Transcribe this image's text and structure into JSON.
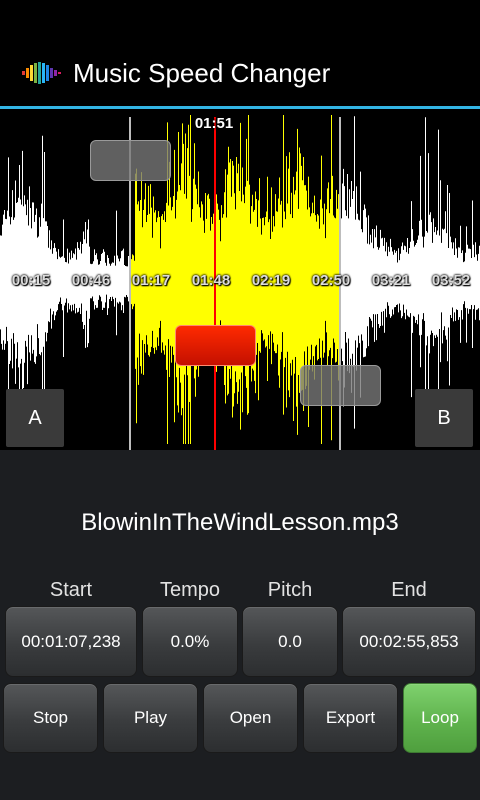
{
  "app": {
    "title": "Music Speed Changer",
    "accent_color": "#33b5e5",
    "logo_icon": "rainbow-waveform-icon"
  },
  "waveform": {
    "current_time": "01:51",
    "time_ticks": [
      "00:15",
      "00:46",
      "01:17",
      "01:48",
      "02:19",
      "02:50",
      "03:21",
      "03:52"
    ],
    "selected_color": "#ffff00",
    "unselected_color": "#ffffff",
    "playhead_color": "#ff0000",
    "marker_a_label": "A",
    "marker_b_label": "B"
  },
  "file": {
    "name": "BlowinInTheWindLesson.mp3"
  },
  "params": {
    "start": {
      "label": "Start",
      "value": "00:01:07,238"
    },
    "tempo": {
      "label": "Tempo",
      "value": "0.0%"
    },
    "pitch": {
      "label": "Pitch",
      "value": "0.0"
    },
    "end": {
      "label": "End",
      "value": "00:02:55,853"
    }
  },
  "controls": {
    "stop": "Stop",
    "play": "Play",
    "open": "Open",
    "export": "Export",
    "loop": "Loop"
  }
}
